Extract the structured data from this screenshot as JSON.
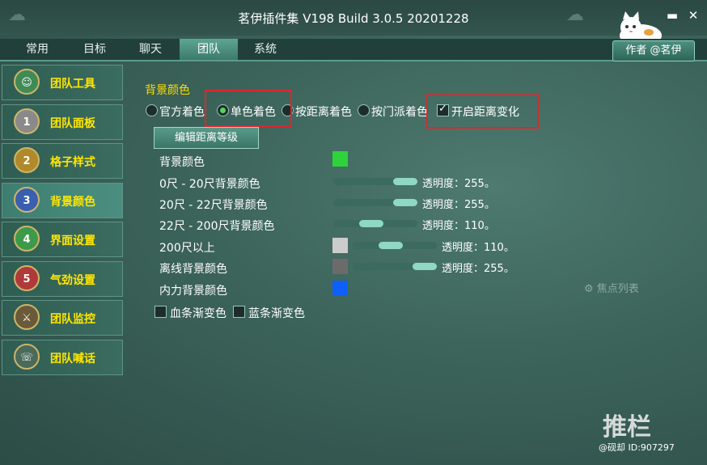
{
  "window": {
    "title": "茗伊插件集 V198 Build 3.0.5 20201228"
  },
  "tabs": [
    {
      "label": "常用"
    },
    {
      "label": "目标"
    },
    {
      "label": "聊天"
    },
    {
      "label": "团队"
    },
    {
      "label": "系统"
    }
  ],
  "author_button": "作者 @茗伊",
  "sidebar": {
    "items": [
      {
        "label": "团队工具",
        "badge": ""
      },
      {
        "label": "团队面板",
        "badge": "1"
      },
      {
        "label": "格子样式",
        "badge": "2"
      },
      {
        "label": "背景颜色",
        "badge": "3"
      },
      {
        "label": "界面设置",
        "badge": "4"
      },
      {
        "label": "气劲设置",
        "badge": "5"
      },
      {
        "label": "团队监控",
        "badge": ""
      },
      {
        "label": "团队喊话",
        "badge": ""
      }
    ]
  },
  "main": {
    "section_title": "背景颜色",
    "radios": [
      {
        "label": "官方着色",
        "selected": false
      },
      {
        "label": "单色着色",
        "selected": true
      },
      {
        "label": "按距离着色",
        "selected": false
      },
      {
        "label": "按门派着色",
        "selected": false
      }
    ],
    "distance_toggle": {
      "label": "开启距离变化",
      "checked": true
    },
    "edit_button": "编辑距离等级",
    "rows": [
      {
        "label": "背景颜色",
        "color": "#2ed33a"
      },
      {
        "label": "0尺 - 20尺背景颜色",
        "alpha_text": "透明度：255。",
        "level": 1.0
      },
      {
        "label": "20尺 - 22尺背景颜色",
        "alpha_text": "透明度：255。",
        "level": 1.0
      },
      {
        "label": "22尺 - 200尺背景颜色",
        "alpha_text": "透明度：110。",
        "level": 0.43
      },
      {
        "label": "200尺以上",
        "color": "#cccccc",
        "alpha_text": "透明度：110。",
        "level": 0.43
      },
      {
        "label": "离线背景颜色",
        "color": "#6b6b6b",
        "alpha_text": "透明度：255。",
        "level": 1.0
      },
      {
        "label": "内力背景颜色",
        "color": "#0f5fff"
      }
    ],
    "gradient_checks": [
      {
        "label": "血条渐变色",
        "checked": false
      },
      {
        "label": "蓝条渐变色",
        "checked": false
      }
    ],
    "focus_list": "焦点列表"
  },
  "watermark": {
    "logo": "推栏",
    "id_text": "@砚却 ID:907297"
  }
}
